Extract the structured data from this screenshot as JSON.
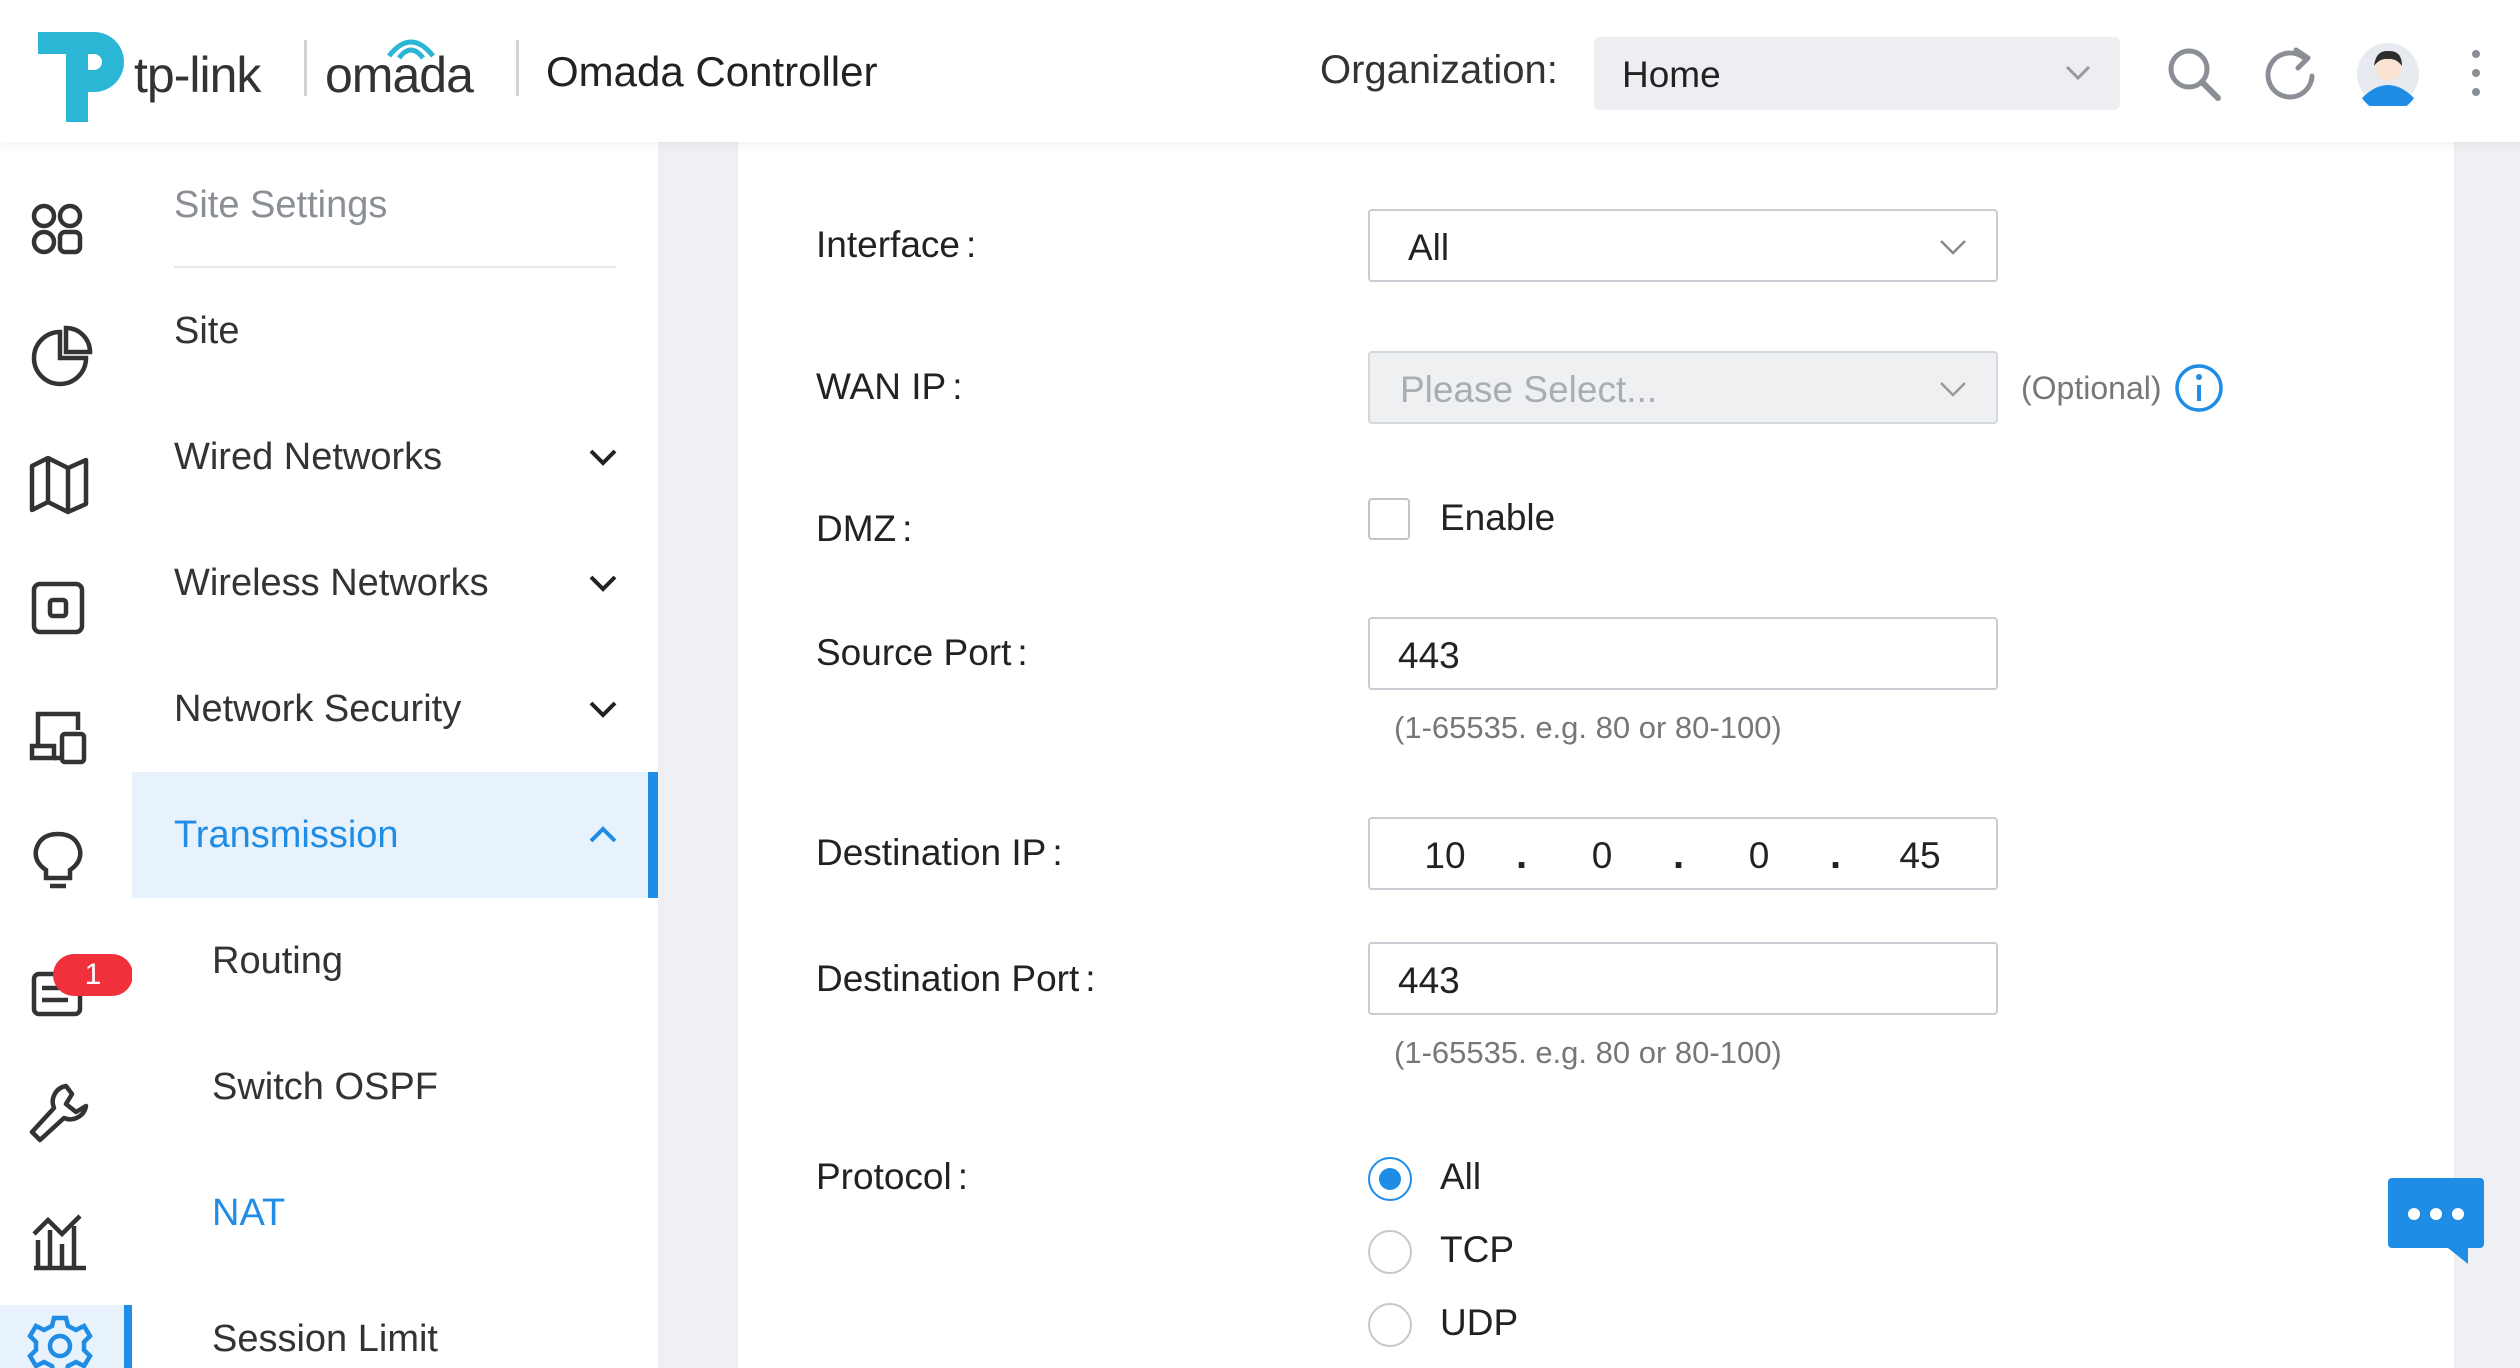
{
  "header": {
    "brand_tplink": "tp-link",
    "brand_omada": "omada",
    "app_title": "Omada Controller",
    "org_label": "Organization:",
    "org_value": "Home",
    "icons": [
      "search-icon",
      "refresh-icon",
      "avatar",
      "more-vertical-icon"
    ]
  },
  "rail": {
    "items": [
      "dashboard-icon",
      "statistics-icon",
      "map-icon",
      "devices-icon",
      "clients-icon",
      "insight-icon",
      "logs-icon",
      "tools-icon",
      "reports-icon",
      "settings-icon"
    ],
    "badge_count": "1",
    "active": "settings-icon"
  },
  "menu": {
    "header": "Site Settings",
    "items": [
      {
        "label": "Site"
      },
      {
        "label": "Wired Networks"
      },
      {
        "label": "Wireless Networks"
      },
      {
        "label": "Network Security"
      },
      {
        "label": "Transmission"
      }
    ],
    "sub_items": [
      {
        "label": "Routing"
      },
      {
        "label": "Switch OSPF"
      },
      {
        "label": "NAT"
      },
      {
        "label": "Session Limit"
      }
    ],
    "active_item": "Transmission",
    "current_sub": "NAT"
  },
  "form": {
    "interface": {
      "label": "Interface",
      "value": "All"
    },
    "wan_ip": {
      "label": "WAN IP",
      "placeholder": "Please Select...",
      "optional": "(Optional)"
    },
    "dmz": {
      "label": "DMZ",
      "checkbox_label": "Enable",
      "checked": false
    },
    "source_port": {
      "label": "Source Port",
      "value": "443",
      "hint": "(1-65535. e.g. 80 or 80-100)"
    },
    "destination_ip": {
      "label": "Destination IP",
      "octets": [
        "10",
        "0",
        "0",
        "45"
      ]
    },
    "destination_port": {
      "label": "Destination Port",
      "value": "443",
      "hint": "(1-65535. e.g. 80 or 80-100)"
    },
    "protocol": {
      "label": "Protocol",
      "options": [
        "All",
        "TCP",
        "UDP"
      ],
      "selected": "All"
    }
  },
  "colors": {
    "accent": "#1f8ce6",
    "badge": "#f0303a",
    "logo": "#2ab6d4"
  }
}
